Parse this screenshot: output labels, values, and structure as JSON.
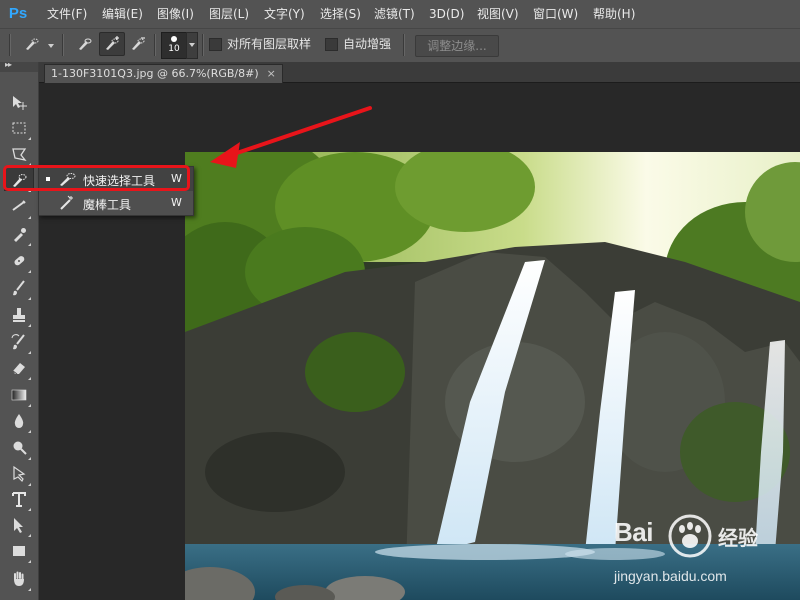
{
  "app": {
    "logo": "Ps",
    "accent": "#31a8ff"
  },
  "menu": [
    "文件(F)",
    "编辑(E)",
    "图像(I)",
    "图层(L)",
    "文字(Y)",
    "选择(S)",
    "滤镜(T)",
    "3D(D)",
    "视图(V)",
    "窗口(W)",
    "帮助(H)"
  ],
  "options": {
    "brush_size": "10",
    "sample_all_layers": "对所有图层取样",
    "auto_enhance": "自动增强",
    "refine_edge": "调整边缘..."
  },
  "document": {
    "tab_title": "1-130F3101Q3.jpg @ 66.7%(RGB/8#)",
    "close": "×"
  },
  "tools": [
    "move-icon",
    "marquee-icon",
    "lasso-icon",
    "quick-selection-icon",
    "crop-icon",
    "eyedropper-icon",
    "healing-brush-icon",
    "brush-icon",
    "clone-stamp-icon",
    "history-brush-icon",
    "eraser-icon",
    "gradient-icon",
    "blur-icon",
    "dodge-icon",
    "pen-icon",
    "type-icon",
    "path-selection-icon",
    "rectangle-icon",
    "hand-icon"
  ],
  "flyout": {
    "items": [
      {
        "label": "快速选择工具",
        "key": "W",
        "icon": "quick-selection-icon",
        "selected": true
      },
      {
        "label": "魔棒工具",
        "key": "W",
        "icon": "magic-wand-icon",
        "selected": false
      }
    ]
  },
  "annotation": {
    "color": "#e8141a"
  },
  "watermark": {
    "brand": "Bai",
    "brand_suffix": "经验",
    "url": "jingyan.baidu.com"
  }
}
